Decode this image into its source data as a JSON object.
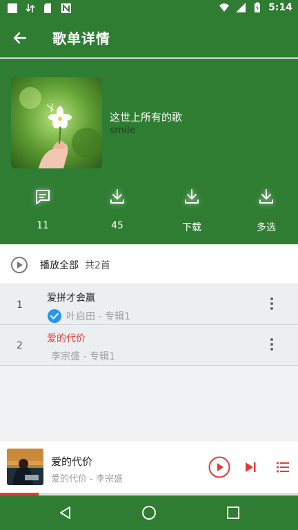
{
  "status_bar": {
    "time": "5:14"
  },
  "toolbar": {
    "title": "歌单详情"
  },
  "playlist": {
    "title": "这世上所有的歌",
    "author": "smile"
  },
  "actions": [
    {
      "icon": "comment-icon",
      "label": "11"
    },
    {
      "icon": "download-icon",
      "label": "45"
    },
    {
      "icon": "download-icon",
      "label": "下载"
    },
    {
      "icon": "download-icon",
      "label": "多选"
    }
  ],
  "play_all": {
    "label": "播放全部",
    "count": "共2首"
  },
  "songs": [
    {
      "index": "1",
      "title": "爱拼才会赢",
      "subtitle": "叶启田 - 专辑1",
      "checked": true,
      "playing": false
    },
    {
      "index": "2",
      "title": "爱的代价",
      "subtitle": "李宗盛 - 专辑1",
      "checked": false,
      "playing": true
    }
  ],
  "now_playing": {
    "title": "爱的代价",
    "subtitle": "爱的代价 - 李宗盛",
    "progress": 0.13
  },
  "colors": {
    "primary": "#2e7d32",
    "accent": "#e53935",
    "check": "#2196f3"
  }
}
